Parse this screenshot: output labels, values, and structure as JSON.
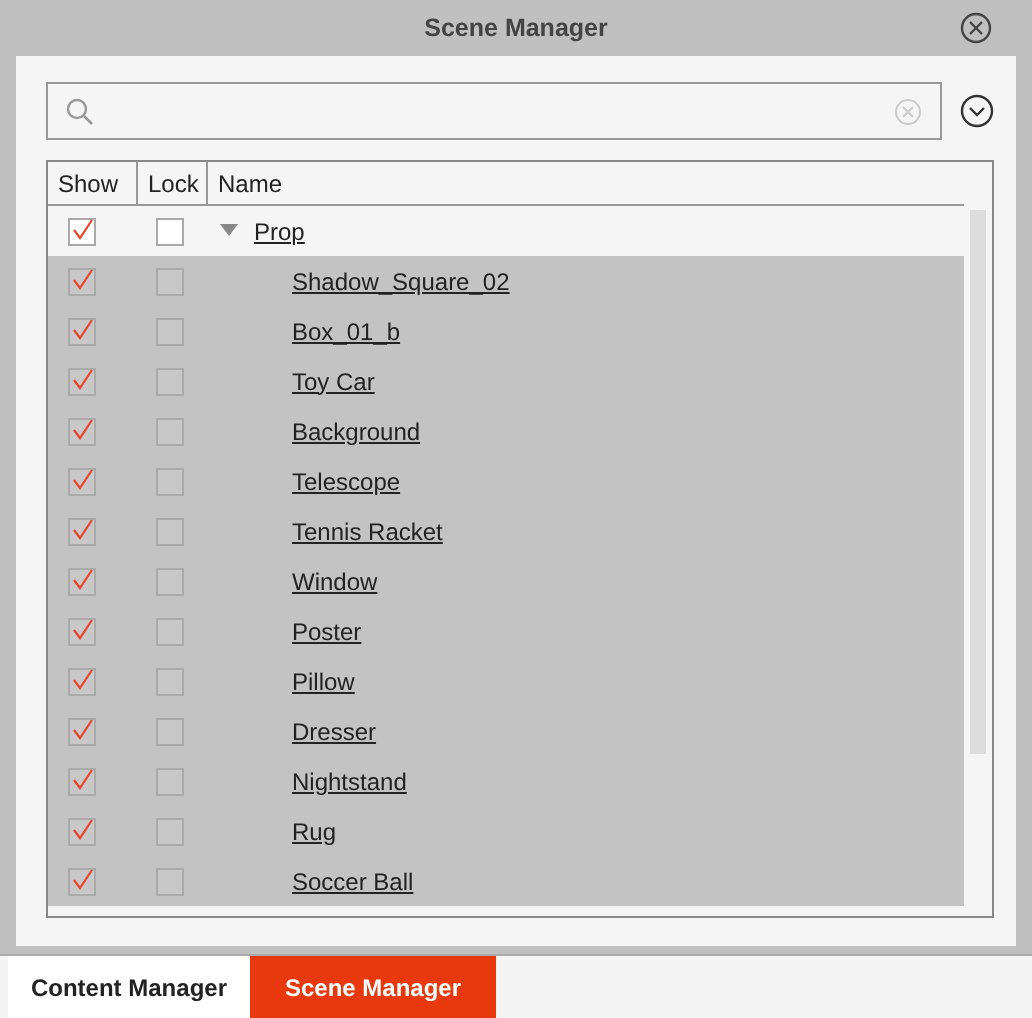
{
  "window": {
    "title": "Scene Manager"
  },
  "table": {
    "columns": [
      "Show",
      "Lock",
      "Name"
    ],
    "rows": [
      {
        "name": "Prop",
        "show": true,
        "lock": false,
        "expanded": true,
        "selected": false,
        "children": [
          {
            "name": "Shadow_Square_02",
            "show": true,
            "lock": false,
            "selected": true
          },
          {
            "name": "Box_01_b",
            "show": true,
            "lock": false,
            "selected": true
          },
          {
            "name": "Toy Car",
            "show": true,
            "lock": false,
            "selected": true
          },
          {
            "name": "Background",
            "show": true,
            "lock": false,
            "selected": true
          },
          {
            "name": "Telescope",
            "show": true,
            "lock": false,
            "selected": true
          },
          {
            "name": "Tennis Racket",
            "show": true,
            "lock": false,
            "selected": true
          },
          {
            "name": "Window",
            "show": true,
            "lock": false,
            "selected": true
          },
          {
            "name": "Poster",
            "show": true,
            "lock": false,
            "selected": true
          },
          {
            "name": "Pillow",
            "show": true,
            "lock": false,
            "selected": true
          },
          {
            "name": "Dresser",
            "show": true,
            "lock": false,
            "selected": true
          },
          {
            "name": "Nightstand",
            "show": true,
            "lock": false,
            "selected": true
          },
          {
            "name": "Rug",
            "show": true,
            "lock": false,
            "selected": true
          },
          {
            "name": "Soccer Ball",
            "show": true,
            "lock": false,
            "selected": true
          }
        ]
      }
    ]
  },
  "tabs": [
    {
      "label": "Content Manager",
      "selected": false
    },
    {
      "label": "Scene Manager",
      "selected": true
    }
  ]
}
